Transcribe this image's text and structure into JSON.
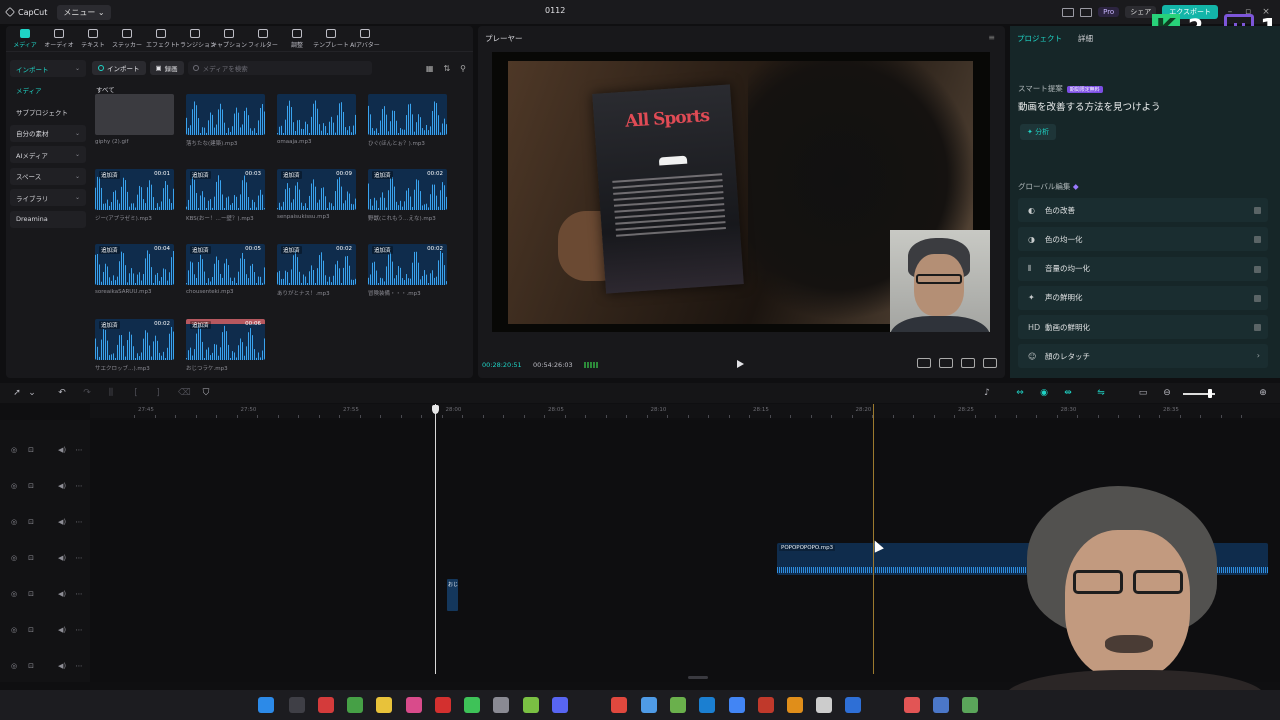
{
  "titlebar": {
    "app_name": "CapCut",
    "menu_label": "メニュー",
    "menu_chevron": "⌄",
    "project_title": "0112",
    "pro_label": "Pro",
    "share_label": "シェア",
    "export_label": "エクスポート"
  },
  "overlay": {
    "k_letter": "K",
    "k_count": "2",
    "twitch_count": "1"
  },
  "toolbar": {
    "tools": [
      {
        "label": "メディア",
        "icon": "media-icon"
      },
      {
        "label": "オーディオ",
        "icon": "audio-icon"
      },
      {
        "label": "テキスト",
        "icon": "text-icon"
      },
      {
        "label": "ステッカー",
        "icon": "sticker-icon"
      },
      {
        "label": "エフェクト",
        "icon": "effect-icon"
      },
      {
        "label": "トランジション",
        "icon": "transition-icon"
      },
      {
        "label": "キャプション",
        "icon": "caption-icon"
      },
      {
        "label": "フィルター",
        "icon": "filter-icon"
      },
      {
        "label": "調整",
        "icon": "adjust-icon"
      },
      {
        "label": "テンプレート",
        "icon": "template-icon"
      },
      {
        "label": "AIアバター",
        "icon": "ai-avatar-icon"
      }
    ]
  },
  "sidebar": {
    "items": [
      {
        "label": "インポート",
        "chevron": "⌄"
      },
      {
        "label": "メディア",
        "chevron": ""
      },
      {
        "label": "サブプロジェクト",
        "chevron": ""
      },
      {
        "label": "自分の素材",
        "chevron": "⌄"
      },
      {
        "label": "AIメディア",
        "chevron": "⌄"
      },
      {
        "label": "スペース",
        "chevron": "⌄"
      },
      {
        "label": "ライブラリ",
        "chevron": "⌄"
      },
      {
        "label": "Dreamina",
        "chevron": ""
      }
    ]
  },
  "media": {
    "import_label": "インポート",
    "record_label": "録画",
    "search_placeholder": "メディアを検索",
    "all_label": "すべて",
    "grid_icon": "▦",
    "sort_icon": "⇅",
    "filter_icon": "⚲",
    "items": [
      {
        "name": "giphy (2).gif",
        "badge": "",
        "duration": "",
        "kind": "gif"
      },
      {
        "name": "落ちたな(建築).mp3",
        "badge": "",
        "duration": "",
        "kind": "audio"
      },
      {
        "name": "omaaja.mp3",
        "badge": "",
        "duration": "",
        "kind": "audio"
      },
      {
        "name": "ひぐ(ほんとぉ？).mp3",
        "badge": "",
        "duration": "",
        "kind": "audio"
      },
      {
        "name": "ジー(アプラゼミ).mp3",
        "badge": "追加済",
        "duration": "00:01",
        "kind": "audio"
      },
      {
        "name": "KBS(おー！…ー壁？).mp3",
        "badge": "追加済",
        "duration": "00:03",
        "kind": "audio"
      },
      {
        "name": "senpaisukissu.mp3",
        "badge": "追加済",
        "duration": "00:09",
        "kind": "audio"
      },
      {
        "name": "野獣(これもう…えな).mp3",
        "badge": "追加済",
        "duration": "00:02",
        "kind": "audio"
      },
      {
        "name": "soreaikaSARUU.mp3",
        "badge": "追加済",
        "duration": "00:04",
        "kind": "audio"
      },
      {
        "name": "chousenteki.mp3",
        "badge": "追加済",
        "duration": "00:05",
        "kind": "audio"
      },
      {
        "name": "ありがとナス！.mp3",
        "badge": "追加済",
        "duration": "00:02",
        "kind": "audio"
      },
      {
        "name": "冒険装備・・・.mp3",
        "badge": "追加済",
        "duration": "00:02",
        "kind": "audio"
      },
      {
        "name": "サエクロッブ…).mp3",
        "badge": "追加済",
        "duration": "00:02",
        "kind": "audio"
      },
      {
        "name": "おじつラケ.mp3",
        "badge": "追加済",
        "duration": "00:06",
        "kind": "audio-red"
      }
    ]
  },
  "player": {
    "title": "プレーヤー",
    "poster_title": "All Sports",
    "current_time": "00:28:20:51",
    "total_time": "00:54:26:03"
  },
  "right_panel": {
    "tabs": [
      "プロジェクト",
      "詳細"
    ],
    "smart_label": "スマート提案",
    "limited_label": "期間限定無料",
    "smart_headline": "動画を改善する方法を見つけよう",
    "analyze_label": "分析",
    "global_label": "グローバル編集",
    "global_items": [
      {
        "label": "色の改善",
        "icon": "◐"
      },
      {
        "label": "色の均一化",
        "icon": "◑"
      },
      {
        "label": "音量の均一化",
        "icon": "⫴"
      },
      {
        "label": "声の鮮明化",
        "icon": "✦"
      },
      {
        "label": "動画の鮮明化",
        "icon": "HD"
      },
      {
        "label": "顔のレタッチ",
        "icon": "☺"
      }
    ]
  },
  "timeline": {
    "ruler_labels": [
      "27:45",
      "27:50",
      "27:55",
      "28:00",
      "28:05",
      "28:10",
      "28:15",
      "28:20",
      "28:25",
      "28:30",
      "28:35"
    ],
    "clip_name": "POPOPOPOPO.mp3",
    "mini_clip_label": "おじ",
    "track_count": 7
  }
}
